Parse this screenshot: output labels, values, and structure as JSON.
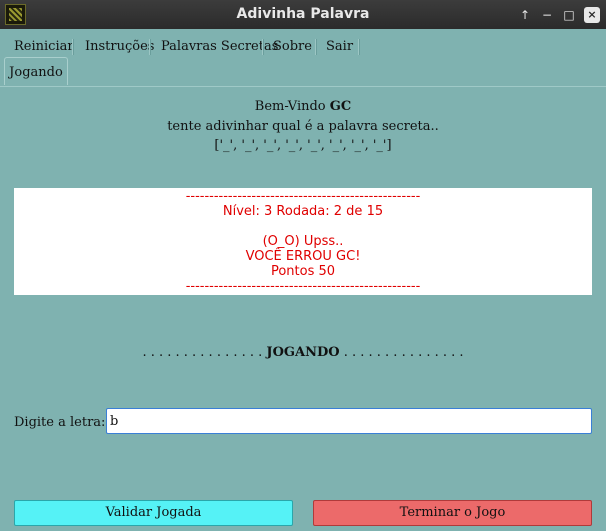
{
  "window": {
    "title": "Adivinha Palavra",
    "controls": {
      "up": "↑",
      "minimize": "−",
      "maximize": "□",
      "close": "×"
    }
  },
  "menu": {
    "items": [
      "Reiniciar",
      "Instruções",
      "Palavras Secretas",
      "Sobre",
      "Sair"
    ]
  },
  "tabs": {
    "active": "Jogando"
  },
  "welcome": {
    "greeting": "Bem-Vindo ",
    "player": "GC",
    "instruction": "tente adivinhar qual é a palavra secreta..",
    "pattern": "['_', '_', '_', '_', '_', '_', '_', '_']"
  },
  "result": {
    "separator_top": "--------------------------------------------------",
    "level": "Nível: 3 Rodada: 2 de 15",
    "face": "(O_O) Upss..",
    "message": "VOCÊ ERROU GC!",
    "points": "Pontos 50",
    "separator_bottom": "--------------------------------------------------"
  },
  "status": {
    "dots_left": ". . . . . . . . . . . . . . . ",
    "label": "JOGANDO",
    "dots_right": " . . . . . . . . . . . . . . ."
  },
  "letter": {
    "label": "Digite a letra:",
    "value": "b"
  },
  "buttons": {
    "validate": "Validar Jogada",
    "end": "Terminar o Jogo"
  },
  "colors": {
    "background": "#7fb2b0",
    "result_text": "#e00000",
    "validate_button": "#55f2f6",
    "end_button": "#ec6a6a"
  }
}
